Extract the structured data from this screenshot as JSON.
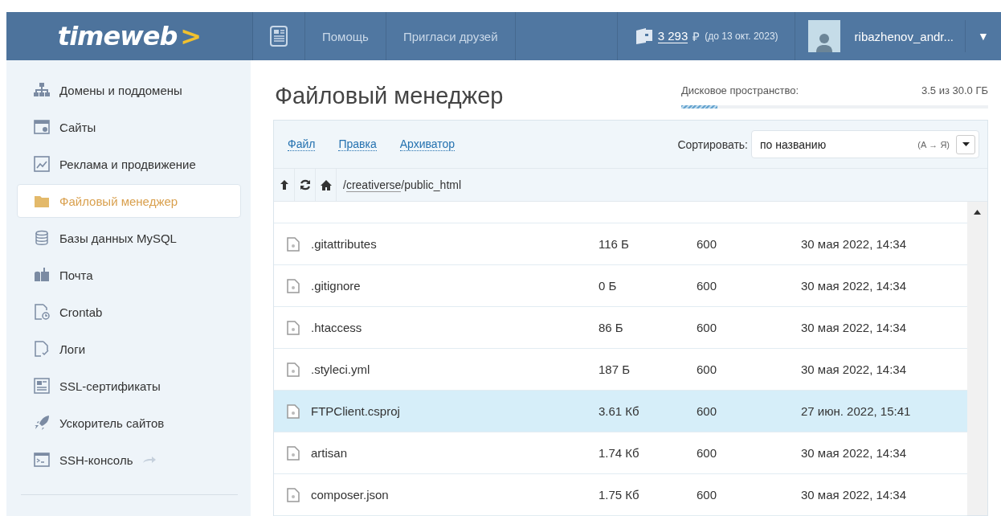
{
  "header": {
    "logo": "timeweb",
    "logo_mark": ">",
    "nav": [
      "Помощь",
      "Пригласи друзей"
    ],
    "balance": {
      "amount": "3 293",
      "currency": "₽",
      "until": "(до 13 окт. 2023)"
    },
    "user": "ribazhenov_andr...",
    "menu_caret": "▼"
  },
  "sidebar": {
    "items": [
      {
        "label": "Домены и поддомены",
        "selected": false
      },
      {
        "label": "Сайты",
        "selected": false
      },
      {
        "label": "Реклама и продвижение",
        "selected": false
      },
      {
        "label": "Файловый менеджер",
        "selected": true
      },
      {
        "label": "Базы данных MySQL",
        "selected": false
      },
      {
        "label": "Почта",
        "selected": false
      },
      {
        "label": "Crontab",
        "selected": false
      },
      {
        "label": "Логи",
        "selected": false
      },
      {
        "label": "SSL-сертификаты",
        "selected": false
      },
      {
        "label": "Ускоритель сайтов",
        "selected": false
      },
      {
        "label": "SSH-консоль",
        "selected": false,
        "external": true
      }
    ]
  },
  "page": {
    "title": "Файловый менеджер",
    "disk": {
      "label": "Дисковое пространство:",
      "value": "3.5 из 30.0 ГБ",
      "level": 0.117
    }
  },
  "toolbar": {
    "menus": [
      "Файл",
      "Правка",
      "Архиватор"
    ],
    "sort_label": "Сортировать:",
    "sort_value": "по названию",
    "sort_order": "(А → Я)"
  },
  "path": {
    "segments": [
      "/",
      "creativerse",
      "/public_html"
    ]
  },
  "files": [
    {
      "name": ".gitattributes",
      "size": "116 Б",
      "perms": "600",
      "modified": "30 мая 2022, 14:34",
      "selected": false
    },
    {
      "name": ".gitignore",
      "size": "0 Б",
      "perms": "600",
      "modified": "30 мая 2022, 14:34",
      "selected": false
    },
    {
      "name": ".htaccess",
      "size": "86 Б",
      "perms": "600",
      "modified": "30 мая 2022, 14:34",
      "selected": false
    },
    {
      "name": ".styleci.yml",
      "size": "187 Б",
      "perms": "600",
      "modified": "30 мая 2022, 14:34",
      "selected": false
    },
    {
      "name": "FTPClient.csproj",
      "size": "3.61 Кб",
      "perms": "600",
      "modified": "27 июн. 2022, 15:41",
      "selected": true
    },
    {
      "name": "artisan",
      "size": "1.74 Кб",
      "perms": "600",
      "modified": "30 мая 2022, 14:34",
      "selected": false
    },
    {
      "name": "composer.json",
      "size": "1.75 Кб",
      "perms": "600",
      "modified": "30 мая 2022, 14:34",
      "selected": false
    }
  ]
}
